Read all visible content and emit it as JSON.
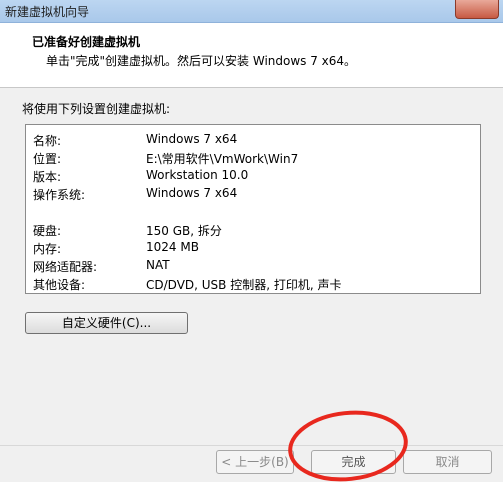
{
  "window": {
    "title": "新建虚拟机向导"
  },
  "header": {
    "title": "已准备好创建虚拟机",
    "subtitle": "单击\"完成\"创建虚拟机。然后可以安装 Windows 7 x64。"
  },
  "intro": "将使用下列设置创建虚拟机:",
  "summary": {
    "rows": [
      {
        "key": "名称:",
        "value": "Windows 7 x64"
      },
      {
        "key": "位置:",
        "value": "E:\\常用软件\\VmWork\\Win7"
      },
      {
        "key": "版本:",
        "value": "Workstation 10.0"
      },
      {
        "key": "操作系统:",
        "value": "Windows 7 x64"
      },
      {
        "key": "硬盘:",
        "value": "150 GB, 拆分"
      },
      {
        "key": "内存:",
        "value": "1024 MB"
      },
      {
        "key": "网络适配器:",
        "value": "NAT"
      },
      {
        "key": "其他设备:",
        "value": "CD/DVD, USB 控制器, 打印机, 声卡"
      }
    ]
  },
  "buttons": {
    "customize": "自定义硬件(C)...",
    "back": "< 上一步(B)",
    "finish": "完成",
    "cancel": "取消"
  },
  "annotation": {
    "color": "#e8281e"
  }
}
